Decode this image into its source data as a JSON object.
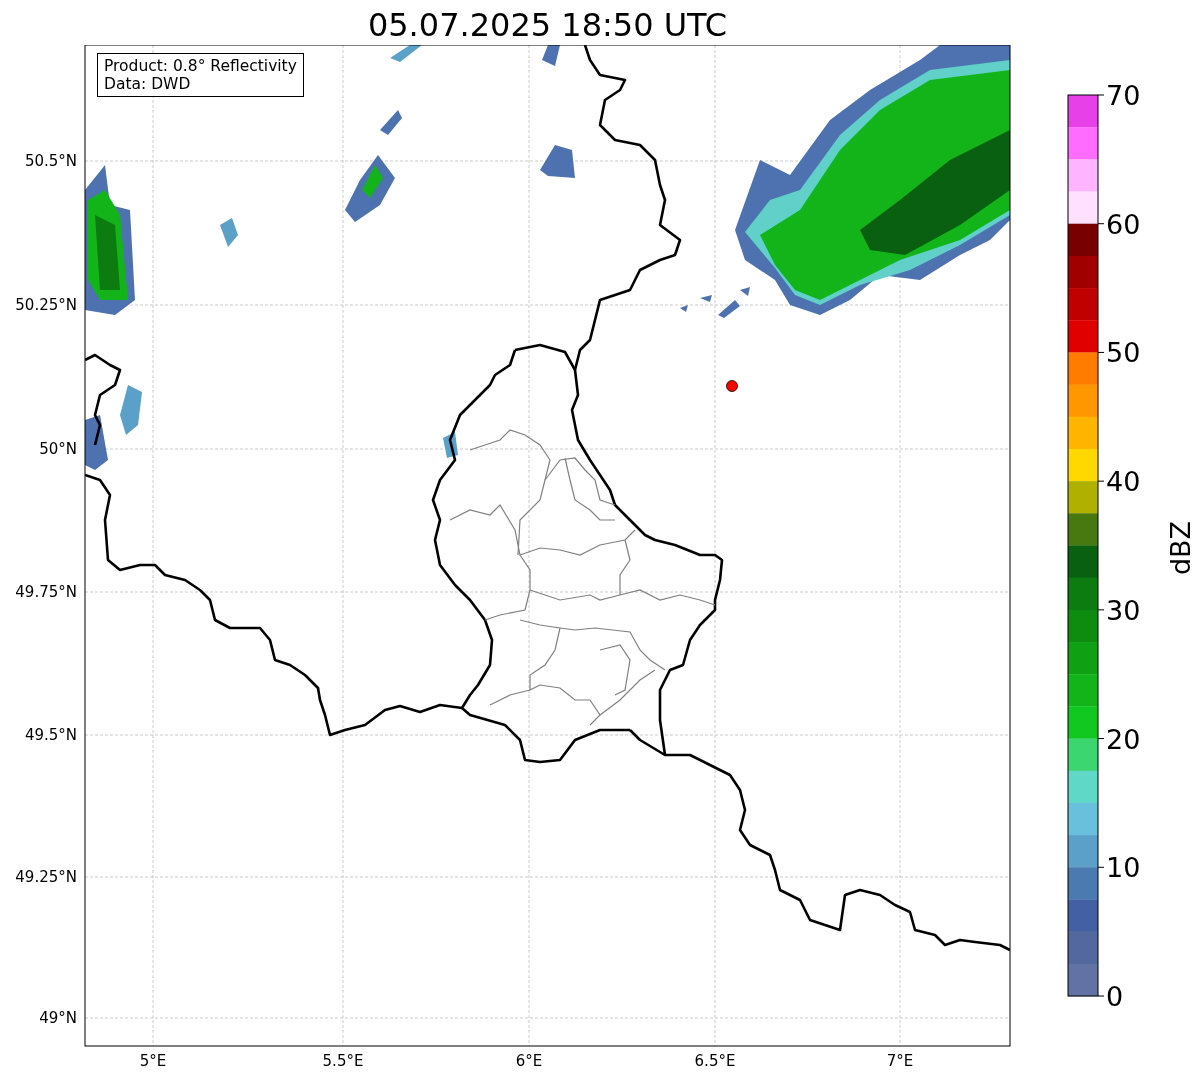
{
  "title": "05.07.2025 18:50 UTC",
  "info_box": [
    "Product: 0.8° Reflectivity",
    "Data: DWD"
  ],
  "map": {
    "lat_ticks": [
      "50.5°N",
      "50.25°N",
      "50°N",
      "49.75°N",
      "49.5°N",
      "49.25°N",
      "49°N"
    ],
    "lon_ticks": [
      "5°E",
      "5.5°E",
      "6°E",
      "6.5°E",
      "7°E"
    ],
    "marker": {
      "color": "#ff0000"
    }
  },
  "colorbar": {
    "label": "dBZ",
    "ticks": [
      "70",
      "60",
      "50",
      "40",
      "30",
      "20",
      "10",
      "0"
    ],
    "bins": [
      {
        "color": "#e840e8"
      },
      {
        "color": "#ff6cff"
      },
      {
        "color": "#ffb4ff"
      },
      {
        "color": "#ffe0ff"
      },
      {
        "color": "#780000"
      },
      {
        "color": "#a00000"
      },
      {
        "color": "#c00000"
      },
      {
        "color": "#e00000"
      },
      {
        "color": "#ff7c00"
      },
      {
        "color": "#ff9800"
      },
      {
        "color": "#ffb400"
      },
      {
        "color": "#ffd800"
      },
      {
        "color": "#b0b000"
      },
      {
        "color": "#487810"
      },
      {
        "color": "#086010"
      },
      {
        "color": "#0c7c10"
      },
      {
        "color": "#0e8c10"
      },
      {
        "color": "#10a014"
      },
      {
        "color": "#12b41a"
      },
      {
        "color": "#10c820"
      },
      {
        "color": "#3cd670"
      },
      {
        "color": "#60d8c8"
      },
      {
        "color": "#68c0dc"
      },
      {
        "color": "#5aa0c8"
      },
      {
        "color": "#4a7ab0"
      },
      {
        "color": "#4460a4"
      },
      {
        "color": "#5468a0"
      },
      {
        "color": "#6272a4"
      }
    ]
  }
}
